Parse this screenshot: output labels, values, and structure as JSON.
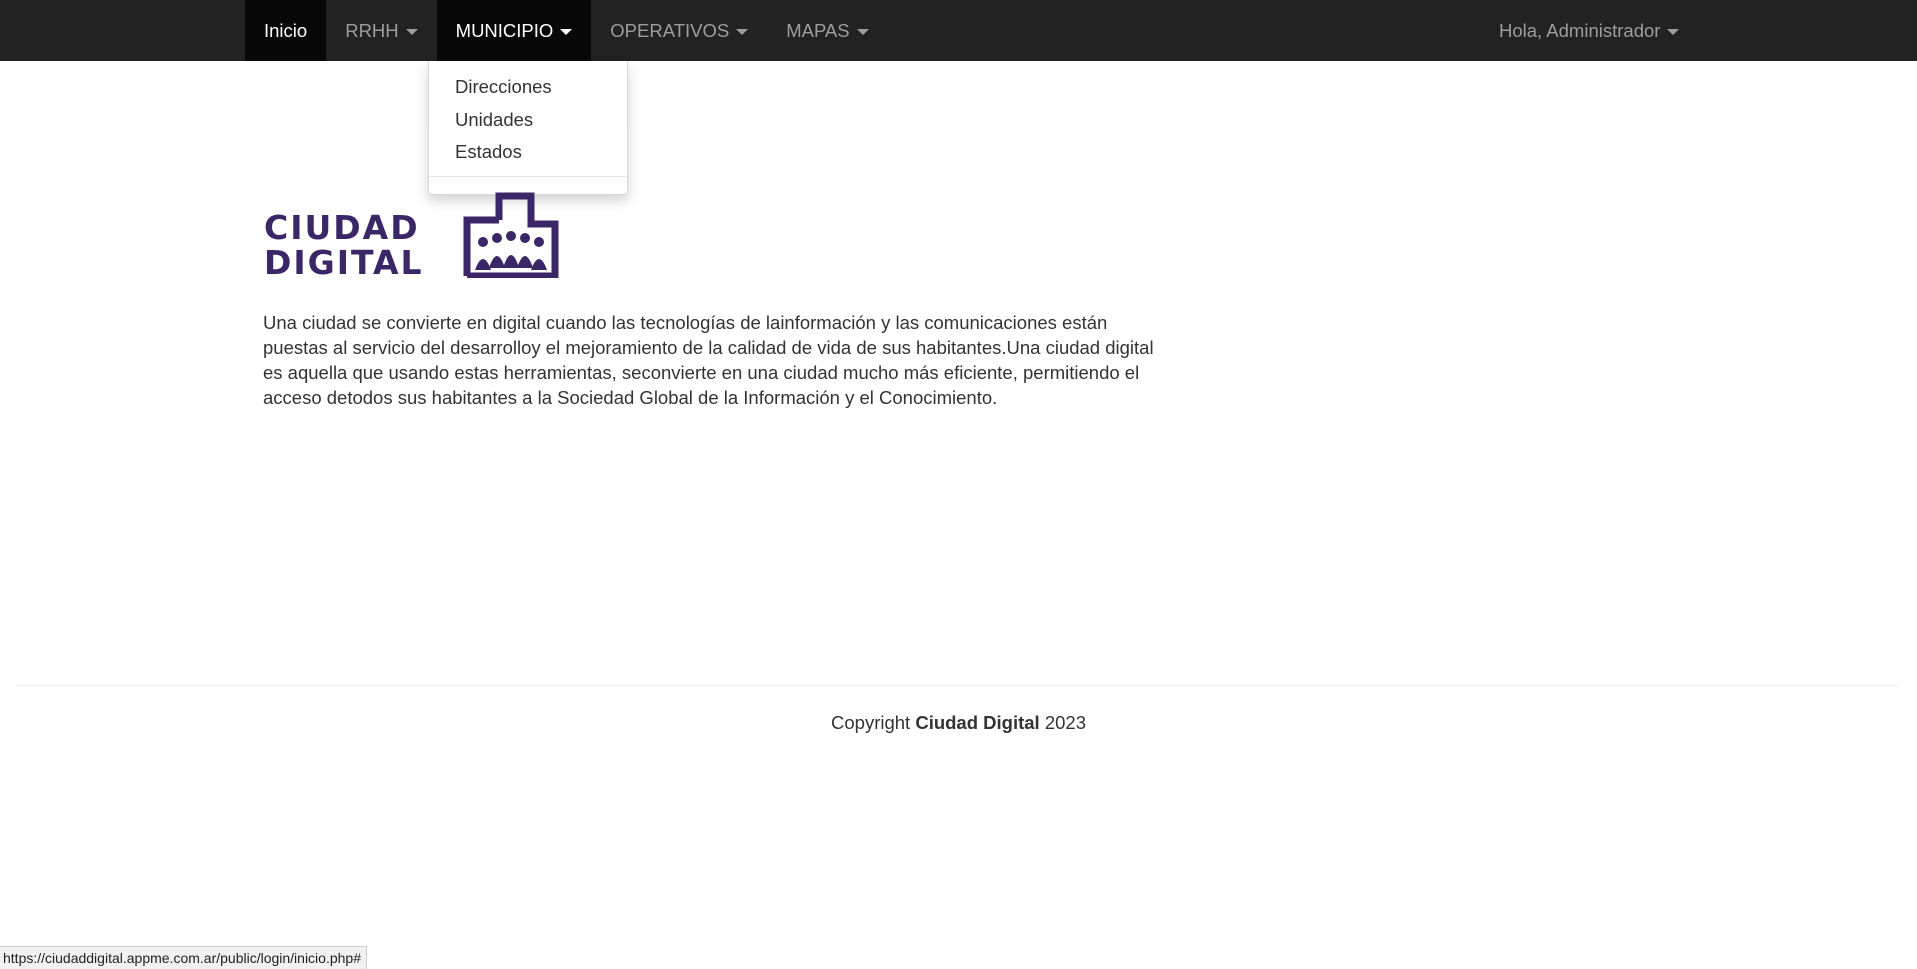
{
  "navbar": {
    "items": [
      {
        "label": "Inicio"
      },
      {
        "label": "RRHH"
      },
      {
        "label": "MUNICIPIO"
      },
      {
        "label": "OPERATIVOS"
      },
      {
        "label": "MAPAS"
      }
    ],
    "user_menu": {
      "label": "Hola, Administrador"
    }
  },
  "dropdown": {
    "items": [
      {
        "label": "Direcciones"
      },
      {
        "label": "Unidades"
      },
      {
        "label": "Estados"
      }
    ]
  },
  "logo": {
    "line1": "CIUDAD",
    "line2": "DIGITAL",
    "color": "#3b2667"
  },
  "main": {
    "intro": "Una ciudad se convierte en digital cuando las tecnologías de lainformación y las comunicaciones están puestas al servicio del desarrolloy el mejoramiento de la calidad de vida de sus habitantes.Una ciudad digital es aquella que usando estas herramientas, seconvierte en una ciudad mucho más eficiente, permitiendo el acceso detodos sus habitantes a la Sociedad Global de la Información y el Conocimiento."
  },
  "footer": {
    "prefix": "Copyright",
    "brand": "Ciudad Digital",
    "year": "2023"
  },
  "statusbar": {
    "url": "https://ciudaddigital.appme.com.ar/public/login/inicio.php#"
  },
  "colors": {
    "navbar_bg": "#222222",
    "navbar_active_bg": "#080808",
    "nav_text": "#9d9d9d",
    "brand_purple": "#3b2667"
  }
}
